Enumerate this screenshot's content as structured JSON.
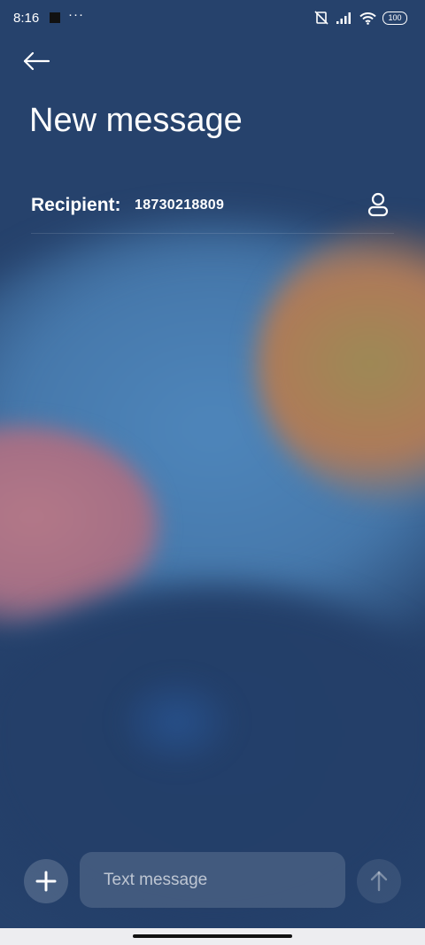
{
  "status_bar": {
    "time": "8:16",
    "dots": "···",
    "battery": "100",
    "icons": [
      "notification-square-icon",
      "mute-vibrate-icon",
      "signal-icon",
      "wifi-icon",
      "battery-icon"
    ]
  },
  "header": {
    "back_icon": "back-arrow-icon",
    "title": "New message"
  },
  "recipient": {
    "label": "Recipient:",
    "value": "18730218809",
    "contact_icon": "contact-person-icon"
  },
  "composer": {
    "attach_icon": "plus-icon",
    "placeholder": "Text message",
    "send_icon": "send-arrow-up-icon"
  },
  "colors": {
    "background": "#26426c",
    "text": "#ffffff",
    "nav_bar": "#ededf0"
  }
}
